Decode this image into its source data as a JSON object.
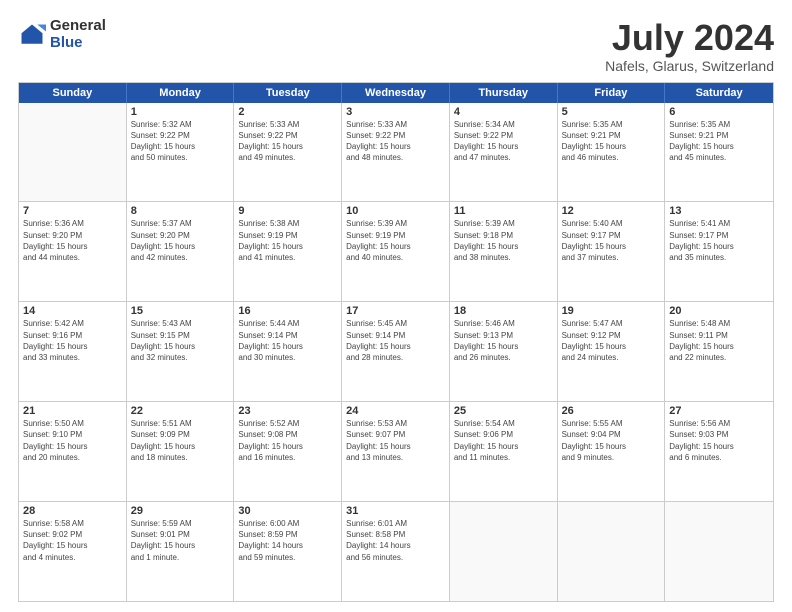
{
  "logo": {
    "general": "General",
    "blue": "Blue"
  },
  "title": "July 2024",
  "location": "Nafels, Glarus, Switzerland",
  "days_header": [
    "Sunday",
    "Monday",
    "Tuesday",
    "Wednesday",
    "Thursday",
    "Friday",
    "Saturday"
  ],
  "weeks": [
    [
      {
        "day": "",
        "info": ""
      },
      {
        "day": "1",
        "info": "Sunrise: 5:32 AM\nSunset: 9:22 PM\nDaylight: 15 hours\nand 50 minutes."
      },
      {
        "day": "2",
        "info": "Sunrise: 5:33 AM\nSunset: 9:22 PM\nDaylight: 15 hours\nand 49 minutes."
      },
      {
        "day": "3",
        "info": "Sunrise: 5:33 AM\nSunset: 9:22 PM\nDaylight: 15 hours\nand 48 minutes."
      },
      {
        "day": "4",
        "info": "Sunrise: 5:34 AM\nSunset: 9:22 PM\nDaylight: 15 hours\nand 47 minutes."
      },
      {
        "day": "5",
        "info": "Sunrise: 5:35 AM\nSunset: 9:21 PM\nDaylight: 15 hours\nand 46 minutes."
      },
      {
        "day": "6",
        "info": "Sunrise: 5:35 AM\nSunset: 9:21 PM\nDaylight: 15 hours\nand 45 minutes."
      }
    ],
    [
      {
        "day": "7",
        "info": "Sunrise: 5:36 AM\nSunset: 9:20 PM\nDaylight: 15 hours\nand 44 minutes."
      },
      {
        "day": "8",
        "info": "Sunrise: 5:37 AM\nSunset: 9:20 PM\nDaylight: 15 hours\nand 42 minutes."
      },
      {
        "day": "9",
        "info": "Sunrise: 5:38 AM\nSunset: 9:19 PM\nDaylight: 15 hours\nand 41 minutes."
      },
      {
        "day": "10",
        "info": "Sunrise: 5:39 AM\nSunset: 9:19 PM\nDaylight: 15 hours\nand 40 minutes."
      },
      {
        "day": "11",
        "info": "Sunrise: 5:39 AM\nSunset: 9:18 PM\nDaylight: 15 hours\nand 38 minutes."
      },
      {
        "day": "12",
        "info": "Sunrise: 5:40 AM\nSunset: 9:17 PM\nDaylight: 15 hours\nand 37 minutes."
      },
      {
        "day": "13",
        "info": "Sunrise: 5:41 AM\nSunset: 9:17 PM\nDaylight: 15 hours\nand 35 minutes."
      }
    ],
    [
      {
        "day": "14",
        "info": "Sunrise: 5:42 AM\nSunset: 9:16 PM\nDaylight: 15 hours\nand 33 minutes."
      },
      {
        "day": "15",
        "info": "Sunrise: 5:43 AM\nSunset: 9:15 PM\nDaylight: 15 hours\nand 32 minutes."
      },
      {
        "day": "16",
        "info": "Sunrise: 5:44 AM\nSunset: 9:14 PM\nDaylight: 15 hours\nand 30 minutes."
      },
      {
        "day": "17",
        "info": "Sunrise: 5:45 AM\nSunset: 9:14 PM\nDaylight: 15 hours\nand 28 minutes."
      },
      {
        "day": "18",
        "info": "Sunrise: 5:46 AM\nSunset: 9:13 PM\nDaylight: 15 hours\nand 26 minutes."
      },
      {
        "day": "19",
        "info": "Sunrise: 5:47 AM\nSunset: 9:12 PM\nDaylight: 15 hours\nand 24 minutes."
      },
      {
        "day": "20",
        "info": "Sunrise: 5:48 AM\nSunset: 9:11 PM\nDaylight: 15 hours\nand 22 minutes."
      }
    ],
    [
      {
        "day": "21",
        "info": "Sunrise: 5:50 AM\nSunset: 9:10 PM\nDaylight: 15 hours\nand 20 minutes."
      },
      {
        "day": "22",
        "info": "Sunrise: 5:51 AM\nSunset: 9:09 PM\nDaylight: 15 hours\nand 18 minutes."
      },
      {
        "day": "23",
        "info": "Sunrise: 5:52 AM\nSunset: 9:08 PM\nDaylight: 15 hours\nand 16 minutes."
      },
      {
        "day": "24",
        "info": "Sunrise: 5:53 AM\nSunset: 9:07 PM\nDaylight: 15 hours\nand 13 minutes."
      },
      {
        "day": "25",
        "info": "Sunrise: 5:54 AM\nSunset: 9:06 PM\nDaylight: 15 hours\nand 11 minutes."
      },
      {
        "day": "26",
        "info": "Sunrise: 5:55 AM\nSunset: 9:04 PM\nDaylight: 15 hours\nand 9 minutes."
      },
      {
        "day": "27",
        "info": "Sunrise: 5:56 AM\nSunset: 9:03 PM\nDaylight: 15 hours\nand 6 minutes."
      }
    ],
    [
      {
        "day": "28",
        "info": "Sunrise: 5:58 AM\nSunset: 9:02 PM\nDaylight: 15 hours\nand 4 minutes."
      },
      {
        "day": "29",
        "info": "Sunrise: 5:59 AM\nSunset: 9:01 PM\nDaylight: 15 hours\nand 1 minute."
      },
      {
        "day": "30",
        "info": "Sunrise: 6:00 AM\nSunset: 8:59 PM\nDaylight: 14 hours\nand 59 minutes."
      },
      {
        "day": "31",
        "info": "Sunrise: 6:01 AM\nSunset: 8:58 PM\nDaylight: 14 hours\nand 56 minutes."
      },
      {
        "day": "",
        "info": ""
      },
      {
        "day": "",
        "info": ""
      },
      {
        "day": "",
        "info": ""
      }
    ]
  ]
}
